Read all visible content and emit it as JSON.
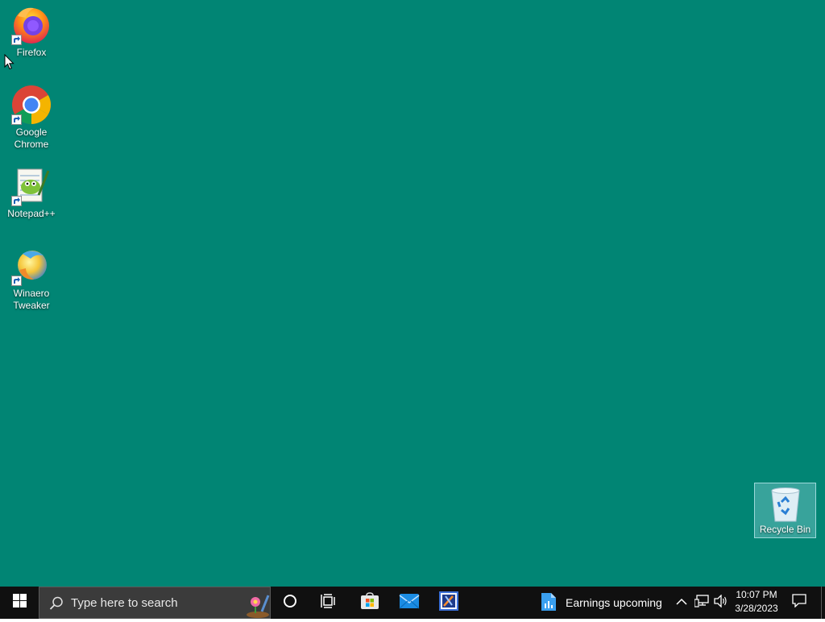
{
  "desktop": {
    "background_color": "#018574",
    "icons": [
      {
        "label": "Firefox",
        "icon": "firefox-icon"
      },
      {
        "label": "Google Chrome",
        "icon": "chrome-icon"
      },
      {
        "label": "Notepad++",
        "icon": "notepad-plus-plus-icon"
      },
      {
        "label": "Winaero Tweaker",
        "icon": "winaero-tweaker-icon"
      }
    ],
    "recycle_bin": {
      "label": "Recycle Bin",
      "icon": "recycle-bin-icon"
    }
  },
  "taskbar": {
    "background_color": "#101010",
    "search": {
      "placeholder": "Type here to search",
      "icon": "search-icon"
    },
    "pinned": [
      {
        "name": "Cortana",
        "icon": "cortana-icon"
      },
      {
        "name": "Task View",
        "icon": "task-view-icon"
      },
      {
        "name": "Microsoft Store",
        "icon": "store-icon"
      },
      {
        "name": "Mail",
        "icon": "mail-icon"
      },
      {
        "name": "App",
        "icon": "app-icon"
      }
    ],
    "news": {
      "text": "Earnings upcoming",
      "icon": "stock-icon"
    },
    "clock": {
      "time": "10:07 PM",
      "date": "3/28/2023"
    }
  }
}
